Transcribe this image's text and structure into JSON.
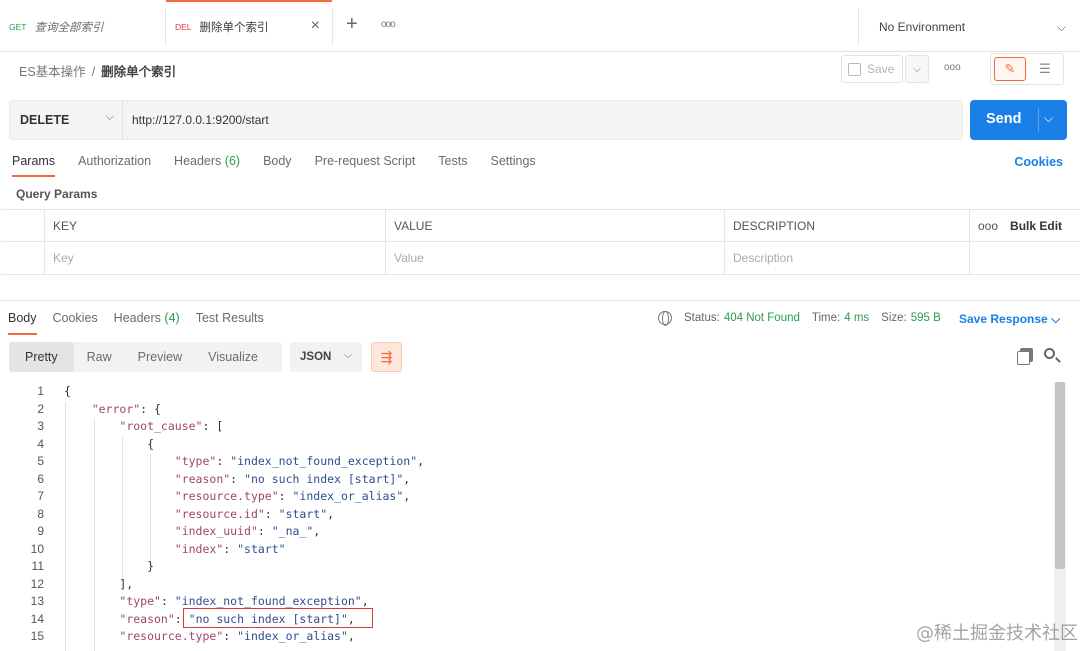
{
  "tabs": [
    {
      "method": "GET",
      "name": "查询全部索引"
    },
    {
      "method": "DEL",
      "name": "删除单个索引"
    }
  ],
  "icons": {
    "close": "×",
    "plus": "+",
    "more": "ooo",
    "chevron": "⌵",
    "pencil": "✎",
    "comment": "☰",
    "wrap": "⇶"
  },
  "environment": "No Environment",
  "breadcrumb": {
    "parent": "ES基本操作",
    "separator": "/",
    "current": "删除单个索引"
  },
  "save_label": "Save",
  "request": {
    "method": "DELETE",
    "url": "http://127.0.0.1:9200/start"
  },
  "send_label": "Send",
  "request_tabs": [
    {
      "label": "Params",
      "count": ""
    },
    {
      "label": "Authorization",
      "count": ""
    },
    {
      "label": "Headers",
      "count": "(6)"
    },
    {
      "label": "Body",
      "count": ""
    },
    {
      "label": "Pre-request Script",
      "count": ""
    },
    {
      "label": "Tests",
      "count": ""
    },
    {
      "label": "Settings",
      "count": ""
    }
  ],
  "cookies_label": "Cookies",
  "query_params_title": "Query Params",
  "params_table": {
    "headers": {
      "key": "KEY",
      "value": "VALUE",
      "description": "DESCRIPTION",
      "bulk_edit": "Bulk Edit"
    },
    "placeholders": {
      "key": "Key",
      "value": "Value",
      "description": "Description"
    }
  },
  "response_tabs": [
    {
      "label": "Body",
      "count": ""
    },
    {
      "label": "Cookies",
      "count": ""
    },
    {
      "label": "Headers",
      "count": "(4)"
    },
    {
      "label": "Test Results",
      "count": ""
    }
  ],
  "status": {
    "status_label": "Status:",
    "status_value": "404 Not Found",
    "time_label": "Time:",
    "time_value": "4 ms",
    "size_label": "Size:",
    "size_value": "595 B"
  },
  "save_response_label": "Save Response",
  "view_modes": [
    "Pretty",
    "Raw",
    "Preview",
    "Visualize"
  ],
  "format": "JSON",
  "code_lines": [
    {
      "n": "1",
      "text": "{"
    },
    {
      "n": "2",
      "text": "    \"error\": {"
    },
    {
      "n": "3",
      "text": "        \"root_cause\": ["
    },
    {
      "n": "4",
      "text": "            {"
    },
    {
      "n": "5",
      "text": "                \"type\": \"index_not_found_exception\","
    },
    {
      "n": "6",
      "text": "                \"reason\": \"no such index [start]\","
    },
    {
      "n": "7",
      "text": "                \"resource.type\": \"index_or_alias\","
    },
    {
      "n": "8",
      "text": "                \"resource.id\": \"start\","
    },
    {
      "n": "9",
      "text": "                \"index_uuid\": \"_na_\","
    },
    {
      "n": "10",
      "text": "                \"index\": \"start\""
    },
    {
      "n": "11",
      "text": "            }"
    },
    {
      "n": "12",
      "text": "        ],"
    },
    {
      "n": "13",
      "text": "        \"type\": \"index_not_found_exception\","
    },
    {
      "n": "14",
      "text": "        \"reason\": \"no such index [start]\","
    },
    {
      "n": "15",
      "text": "        \"resource.type\": \"index_or_alias\","
    }
  ],
  "watermark": "@稀土掘金技术社区"
}
